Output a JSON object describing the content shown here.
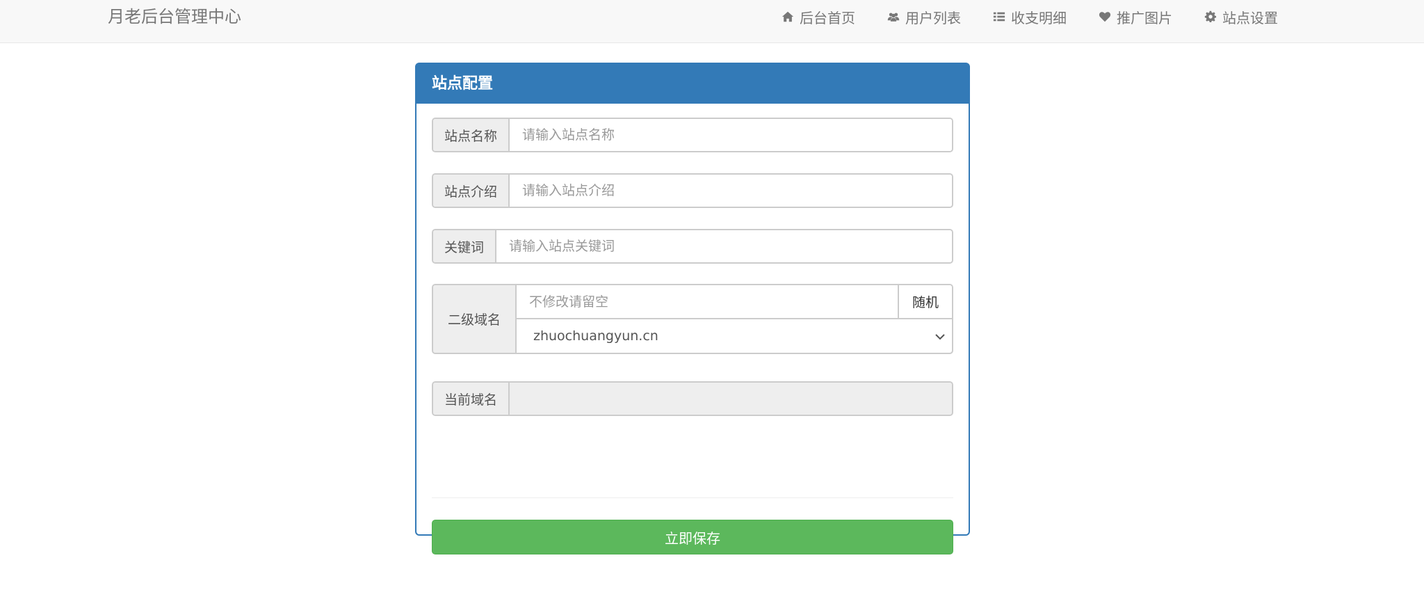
{
  "app": {
    "title": "月老后台管理中心"
  },
  "nav": {
    "items": [
      {
        "label": "后台首页",
        "icon": "home-icon"
      },
      {
        "label": "用户列表",
        "icon": "users-icon"
      },
      {
        "label": "收支明细",
        "icon": "list-icon"
      },
      {
        "label": "推广图片",
        "icon": "heart-icon"
      },
      {
        "label": "站点设置",
        "icon": "gear-icon"
      }
    ]
  },
  "panel": {
    "title": "站点配置"
  },
  "form": {
    "site_name": {
      "label": "站点名称",
      "value": "",
      "placeholder": "请输入站点名称"
    },
    "site_intro": {
      "label": "站点介绍",
      "value": "",
      "placeholder": "请输入站点介绍"
    },
    "keywords": {
      "label": "关键词",
      "value": "",
      "placeholder": "请输入站点关键词"
    },
    "subdomain": {
      "label": "二级域名",
      "value": "",
      "placeholder": "不修改请留空",
      "random_label": "随机",
      "selected_domain": "zhuochuangyun.cn"
    },
    "current_domain": {
      "label": "当前域名",
      "value": ""
    },
    "save_label": "立即保存"
  },
  "colors": {
    "primary": "#337ab7",
    "success": "#5cb85c",
    "navbar": "#f8f8f8"
  }
}
